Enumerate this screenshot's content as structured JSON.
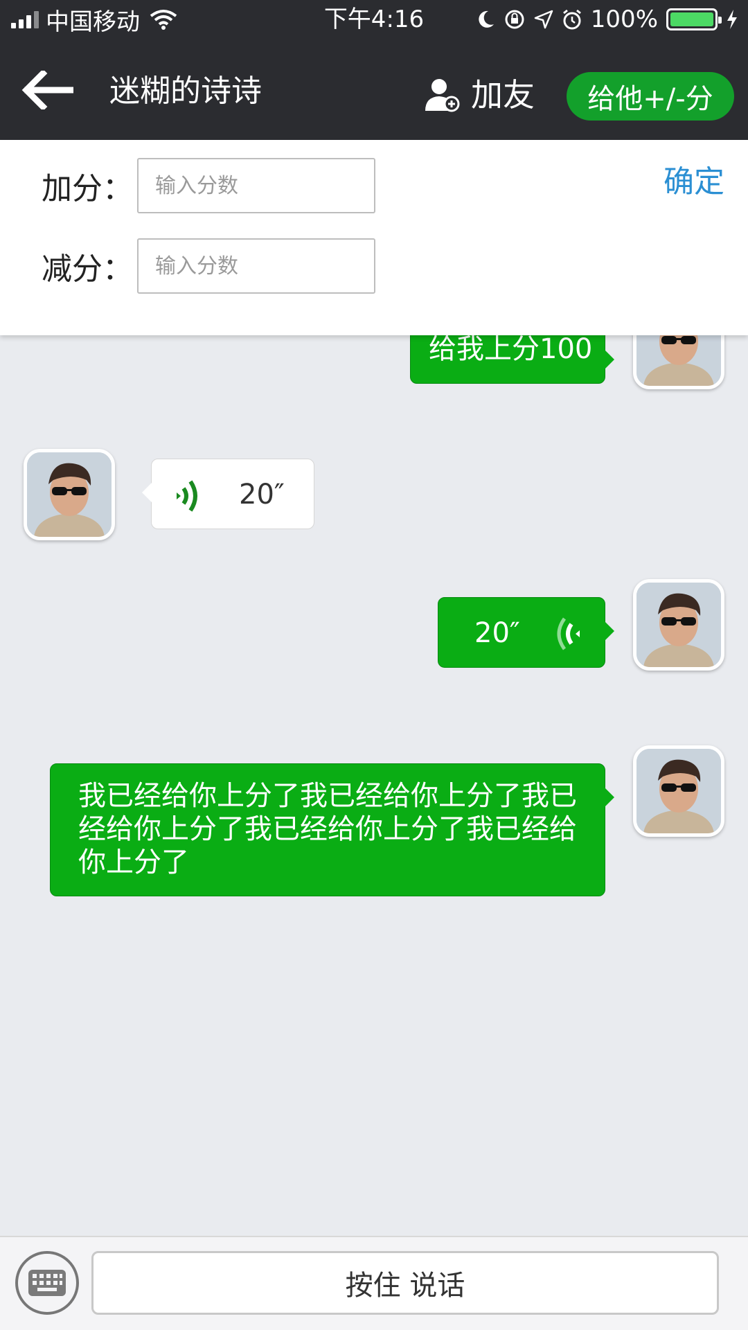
{
  "status_bar": {
    "carrier": "中国移动",
    "time": "下午4:16",
    "battery": "100%",
    "battery_level": 1.0
  },
  "nav": {
    "title": "迷糊的诗诗",
    "add_friend_label": "加友",
    "score_button_label": "给他+/-分"
  },
  "score_panel": {
    "add_label": "加分：",
    "add_placeholder": "输入分数",
    "subtract_label": "减分：",
    "subtract_placeholder": "输入分数",
    "confirm_label": "确定"
  },
  "messages": [
    {
      "side": "right",
      "type": "text",
      "text": "给我上分100"
    },
    {
      "side": "left",
      "type": "voice",
      "duration": "20″"
    },
    {
      "side": "right",
      "type": "voice",
      "duration": "20″"
    },
    {
      "side": "right",
      "type": "text",
      "text": "我已经给你上分了我已经给你上分了我已经给你上分了我已经给你上分了我已经给你上分了"
    }
  ],
  "bottom_bar": {
    "talk_label": "按住 说话"
  },
  "colors": {
    "nav_bg": "#2b2c30",
    "bubble_green": "#0aad14",
    "confirm_blue": "#2b8fd3",
    "chat_bg": "#e9ebef"
  }
}
